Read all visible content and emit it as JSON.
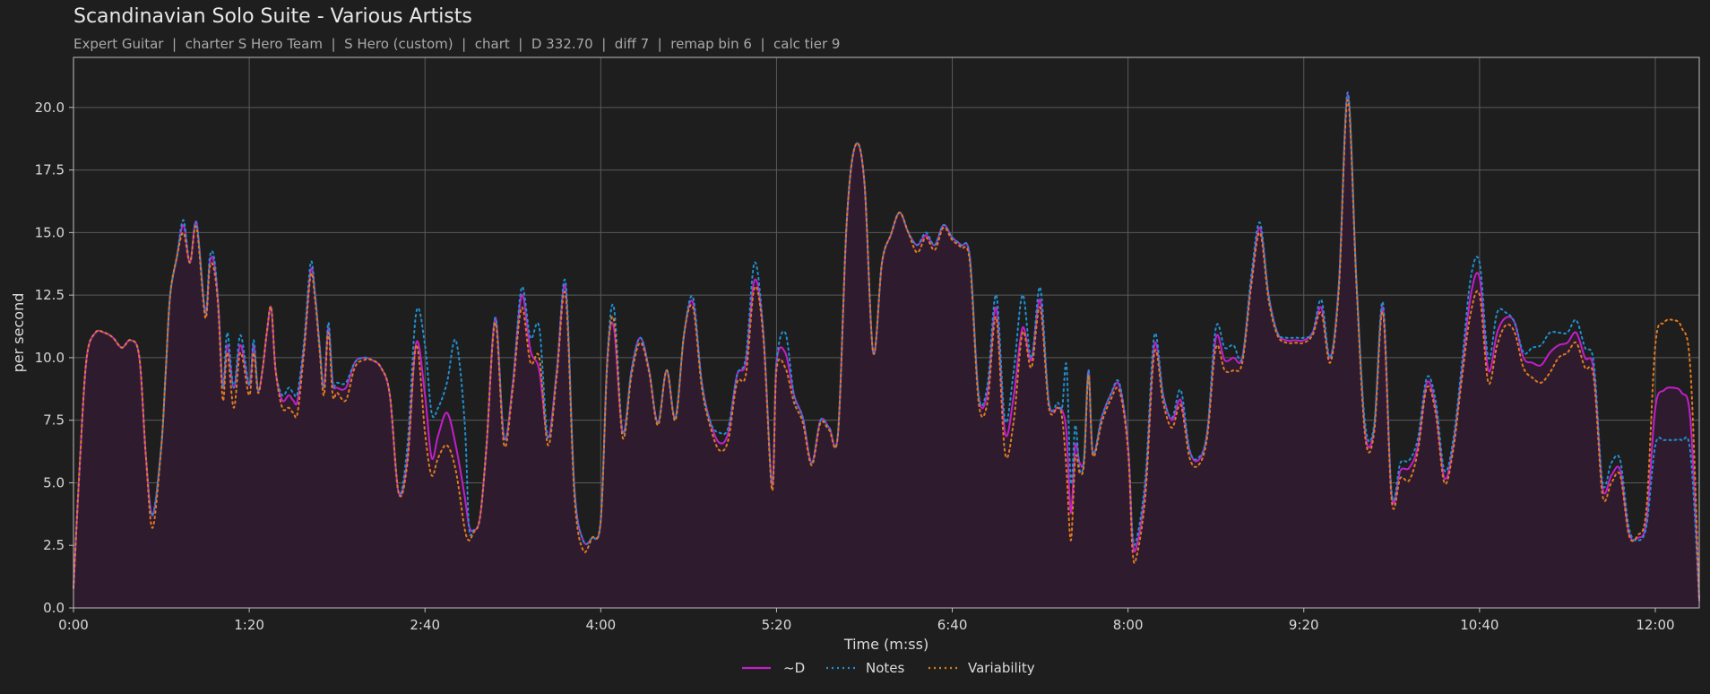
{
  "header": {
    "title": "Scandinavian Solo Suite - Various Artists",
    "subtitle": "Expert Guitar  |  charter S Hero Team  |  S Hero (custom)  |  chart  |  D 332.70  |  diff 7  |  remap bin 6  |  calc tier 9"
  },
  "chart_data": {
    "type": "line",
    "xlabel": "Time (m:ss)",
    "ylabel": "per second",
    "xlim": [
      0,
      740
    ],
    "ylim": [
      0,
      22
    ],
    "grid": true,
    "legend_position": "bottom-center",
    "x_ticks": [
      {
        "v": 0,
        "label": "0:00"
      },
      {
        "v": 80,
        "label": "1:20"
      },
      {
        "v": 160,
        "label": "2:40"
      },
      {
        "v": 240,
        "label": "4:00"
      },
      {
        "v": 320,
        "label": "5:20"
      },
      {
        "v": 400,
        "label": "6:40"
      },
      {
        "v": 480,
        "label": "8:00"
      },
      {
        "v": 560,
        "label": "9:20"
      },
      {
        "v": 640,
        "label": "10:40"
      },
      {
        "v": 720,
        "label": "12:00"
      }
    ],
    "y_ticks": [
      {
        "v": 0,
        "label": "0.0"
      },
      {
        "v": 2.5,
        "label": "2.5"
      },
      {
        "v": 5,
        "label": "5.0"
      },
      {
        "v": 7.5,
        "label": "7.5"
      },
      {
        "v": 10,
        "label": "10.0"
      },
      {
        "v": 12.5,
        "label": "12.5"
      },
      {
        "v": 15,
        "label": "15.0"
      },
      {
        "v": 17.5,
        "label": "17.5"
      },
      {
        "v": 20,
        "label": "20.0"
      }
    ],
    "x": [
      0,
      3,
      6,
      10,
      14,
      18,
      22,
      26,
      30,
      33,
      36,
      40,
      42,
      44,
      47,
      50,
      53,
      56,
      60,
      62,
      64,
      66,
      68,
      70,
      73,
      76,
      80,
      82,
      84,
      86,
      88,
      90,
      92,
      95,
      98,
      100,
      102,
      105,
      108,
      110,
      112,
      114,
      116,
      118,
      120,
      124,
      128,
      132,
      136,
      140,
      144,
      148,
      152,
      156,
      160,
      163,
      166,
      170,
      174,
      178,
      180,
      182,
      185,
      188,
      192,
      196,
      200,
      204,
      208,
      212,
      216,
      220,
      224,
      228,
      232,
      236,
      240,
      243,
      246,
      250,
      254,
      258,
      262,
      266,
      270,
      274,
      278,
      282,
      286,
      290,
      294,
      298,
      302,
      306,
      310,
      314,
      318,
      320,
      324,
      328,
      332,
      336,
      340,
      344,
      348,
      352,
      356,
      360,
      364,
      368,
      372,
      376,
      380,
      384,
      388,
      392,
      396,
      400,
      404,
      408,
      412,
      416,
      420,
      424,
      428,
      432,
      436,
      440,
      444,
      448,
      450,
      452,
      454,
      456,
      458,
      460,
      462,
      464,
      468,
      472,
      476,
      480,
      482,
      484,
      488,
      492,
      496,
      500,
      504,
      508,
      512,
      516,
      520,
      524,
      528,
      532,
      536,
      540,
      544,
      548,
      552,
      556,
      560,
      564,
      568,
      572,
      576,
      580,
      584,
      588,
      592,
      596,
      600,
      604,
      608,
      612,
      616,
      620,
      624,
      628,
      632,
      636,
      640,
      644,
      648,
      652,
      656,
      660,
      664,
      668,
      672,
      676,
      680,
      684,
      688,
      692,
      696,
      700,
      704,
      708,
      712,
      716,
      720,
      724,
      728,
      732,
      736,
      740
    ],
    "series": [
      {
        "name": "~D",
        "color": "#c21fc8",
        "dash": "solid",
        "values": [
          0.8,
          6.0,
          10.0,
          11.0,
          11.0,
          10.8,
          10.4,
          10.7,
          10.0,
          6.0,
          3.7,
          6.5,
          9.5,
          12.5,
          14.0,
          15.3,
          13.8,
          15.4,
          11.8,
          13.8,
          13.8,
          12.0,
          8.8,
          10.5,
          8.8,
          10.5,
          8.9,
          10.5,
          8.7,
          9.5,
          11.0,
          12.0,
          9.5,
          8.3,
          8.5,
          8.3,
          8.3,
          10.5,
          13.5,
          12.5,
          10.5,
          8.8,
          11.2,
          9.0,
          8.8,
          8.8,
          9.8,
          10.0,
          9.9,
          9.6,
          8.5,
          4.6,
          6.0,
          10.6,
          8.5,
          6.0,
          6.9,
          7.8,
          6.5,
          4.5,
          3.3,
          3.1,
          3.6,
          6.5,
          11.6,
          6.8,
          9.0,
          12.5,
          10.3,
          9.5,
          6.8,
          9.5,
          12.8,
          4.8,
          2.7,
          2.8,
          3.5,
          10.0,
          11.2,
          7.0,
          9.5,
          10.8,
          9.5,
          7.4,
          9.5,
          7.6,
          11.0,
          12.2,
          9.0,
          7.4,
          6.6,
          7.0,
          9.3,
          9.8,
          13.1,
          11.0,
          4.9,
          9.8,
          10.2,
          8.5,
          7.6,
          5.8,
          7.5,
          7.2,
          7.0,
          15.5,
          18.5,
          17.0,
          10.2,
          13.8,
          14.9,
          15.8,
          15.0,
          14.5,
          14.9,
          14.5,
          15.3,
          14.8,
          14.5,
          14.0,
          8.5,
          8.6,
          12.0,
          7.0,
          8.5,
          11.2,
          9.9,
          12.3,
          8.2,
          8.0,
          7.9,
          7.0,
          3.8,
          6.5,
          5.8,
          6.0,
          9.5,
          6.2,
          7.6,
          8.5,
          8.9,
          6.5,
          2.8,
          2.5,
          5.0,
          10.5,
          8.5,
          7.5,
          8.3,
          6.3,
          5.9,
          7.0,
          10.8,
          9.9,
          10.0,
          10.0,
          13.0,
          15.2,
          12.5,
          11.0,
          10.7,
          10.7,
          10.7,
          11.0,
          12.0,
          10.0,
          13.0,
          20.5,
          13.0,
          7.0,
          7.2,
          12.0,
          4.5,
          5.5,
          5.6,
          6.5,
          9.0,
          8.0,
          5.2,
          6.5,
          9.5,
          12.5,
          13.2,
          9.5,
          11.0,
          11.6,
          11.4,
          10.0,
          9.8,
          9.7,
          10.2,
          10.5,
          10.6,
          11.0,
          10.0,
          9.5,
          4.8,
          5.3,
          5.5,
          3.0,
          2.8,
          3.5,
          8.0,
          8.7,
          8.8,
          8.6,
          7.5,
          0.3
        ]
      },
      {
        "name": "Notes",
        "color": "#1f8fd0",
        "dash": "2,4",
        "values": [
          0.8,
          6.0,
          10.0,
          11.0,
          11.0,
          10.8,
          10.4,
          10.7,
          10.0,
          6.0,
          3.7,
          6.5,
          9.5,
          12.5,
          14.0,
          15.5,
          13.8,
          15.4,
          11.8,
          14.0,
          14.0,
          12.0,
          8.8,
          11.0,
          8.8,
          10.9,
          8.9,
          10.7,
          8.7,
          9.5,
          11.0,
          12.0,
          9.5,
          8.5,
          8.8,
          8.6,
          8.6,
          10.7,
          13.8,
          12.5,
          10.5,
          8.8,
          11.4,
          9.0,
          9.0,
          9.0,
          9.8,
          10.0,
          9.9,
          9.6,
          8.5,
          4.6,
          6.5,
          11.8,
          10.5,
          7.8,
          8.0,
          9.0,
          10.7,
          7.5,
          3.3,
          3.1,
          3.6,
          6.5,
          11.6,
          6.8,
          9.0,
          12.8,
          10.8,
          11.2,
          6.8,
          9.5,
          13.0,
          4.8,
          2.7,
          2.8,
          3.5,
          10.0,
          12.0,
          7.0,
          9.5,
          10.8,
          9.5,
          7.4,
          9.5,
          7.6,
          11.0,
          12.4,
          9.0,
          7.4,
          7.0,
          7.2,
          9.3,
          10.0,
          13.8,
          11.0,
          4.9,
          9.8,
          11.0,
          8.5,
          7.6,
          5.8,
          7.5,
          7.2,
          7.0,
          15.5,
          18.5,
          17.0,
          10.2,
          13.8,
          14.9,
          15.8,
          15.0,
          14.5,
          15.0,
          14.5,
          15.3,
          14.8,
          14.5,
          14.0,
          8.5,
          8.9,
          12.5,
          7.5,
          9.5,
          12.5,
          10.0,
          12.8,
          8.2,
          8.2,
          8.0,
          9.7,
          5.0,
          7.3,
          5.5,
          6.0,
          9.5,
          6.2,
          7.6,
          8.5,
          9.0,
          6.5,
          3.0,
          2.8,
          5.3,
          10.9,
          8.5,
          7.6,
          8.7,
          6.3,
          6.0,
          7.0,
          11.2,
          10.4,
          10.5,
          10.0,
          13.2,
          15.4,
          12.5,
          11.0,
          10.8,
          10.8,
          10.8,
          11.0,
          12.3,
          10.0,
          13.0,
          20.6,
          13.0,
          7.3,
          7.3,
          12.2,
          4.6,
          5.8,
          5.9,
          6.8,
          9.2,
          8.3,
          5.5,
          6.7,
          9.8,
          13.2,
          13.8,
          10.0,
          11.8,
          11.8,
          11.4,
          10.2,
          10.4,
          10.5,
          11.0,
          11.0,
          11.0,
          11.5,
          10.4,
          9.8,
          5.0,
          5.8,
          5.9,
          3.2,
          2.7,
          3.3,
          6.5,
          6.7,
          6.7,
          6.7,
          6.2,
          0.3
        ]
      },
      {
        "name": "Variability",
        "color": "#e07a1f",
        "dash": "2,4",
        "values": [
          0.8,
          6.0,
          10.0,
          11.0,
          11.0,
          10.8,
          10.4,
          10.7,
          10.0,
          6.0,
          3.2,
          6.5,
          9.5,
          12.5,
          14.0,
          15.0,
          13.8,
          15.2,
          11.6,
          13.6,
          13.5,
          11.8,
          8.3,
          10.2,
          8.0,
          10.2,
          8.5,
          10.2,
          8.6,
          9.5,
          11.0,
          12.0,
          9.5,
          8.0,
          8.0,
          7.8,
          7.8,
          10.3,
          13.3,
          12.3,
          10.3,
          8.5,
          11.0,
          8.5,
          8.6,
          8.3,
          9.6,
          9.9,
          9.9,
          9.6,
          8.5,
          4.6,
          5.8,
          10.5,
          7.0,
          5.3,
          6.0,
          6.5,
          5.5,
          3.2,
          2.7,
          3.0,
          3.6,
          6.5,
          11.4,
          6.5,
          8.8,
          12.0,
          9.8,
          10.0,
          6.5,
          9.3,
          12.5,
          4.5,
          2.3,
          2.8,
          3.5,
          9.8,
          11.5,
          6.8,
          9.3,
          10.6,
          9.4,
          7.3,
          9.5,
          7.5,
          11.0,
          12.0,
          8.8,
          7.2,
          6.3,
          6.7,
          9.0,
          9.3,
          12.8,
          10.8,
          4.7,
          9.5,
          9.6,
          8.2,
          7.4,
          5.7,
          7.4,
          7.1,
          7.0,
          15.5,
          18.5,
          17.0,
          10.2,
          13.8,
          14.9,
          15.8,
          15.0,
          14.2,
          14.8,
          14.3,
          15.2,
          14.7,
          14.4,
          13.8,
          8.2,
          8.2,
          11.6,
          6.2,
          7.5,
          11.0,
          9.6,
          12.0,
          8.0,
          8.0,
          7.6,
          5.5,
          2.7,
          6.0,
          5.4,
          5.8,
          9.3,
          6.1,
          7.4,
          8.3,
          8.7,
          6.3,
          2.3,
          2.1,
          4.6,
          10.2,
          8.2,
          7.2,
          8.1,
          6.0,
          5.7,
          6.8,
          10.4,
          9.5,
          9.5,
          9.8,
          12.8,
          15.0,
          12.3,
          10.9,
          10.6,
          10.6,
          10.6,
          10.9,
          11.8,
          9.8,
          12.8,
          20.3,
          12.8,
          6.8,
          7.0,
          11.8,
          4.3,
          5.2,
          5.1,
          6.3,
          8.8,
          7.8,
          5.0,
          6.3,
          9.2,
          11.8,
          12.5,
          9.0,
          10.5,
          11.3,
          11.0,
          9.6,
          9.2,
          9.0,
          9.4,
          10.0,
          10.2,
          10.6,
          9.6,
          9.2,
          4.5,
          5.0,
          5.3,
          2.9,
          2.9,
          4.0,
          10.5,
          11.4,
          11.5,
          11.2,
          9.5,
          0.3
        ]
      }
    ]
  }
}
